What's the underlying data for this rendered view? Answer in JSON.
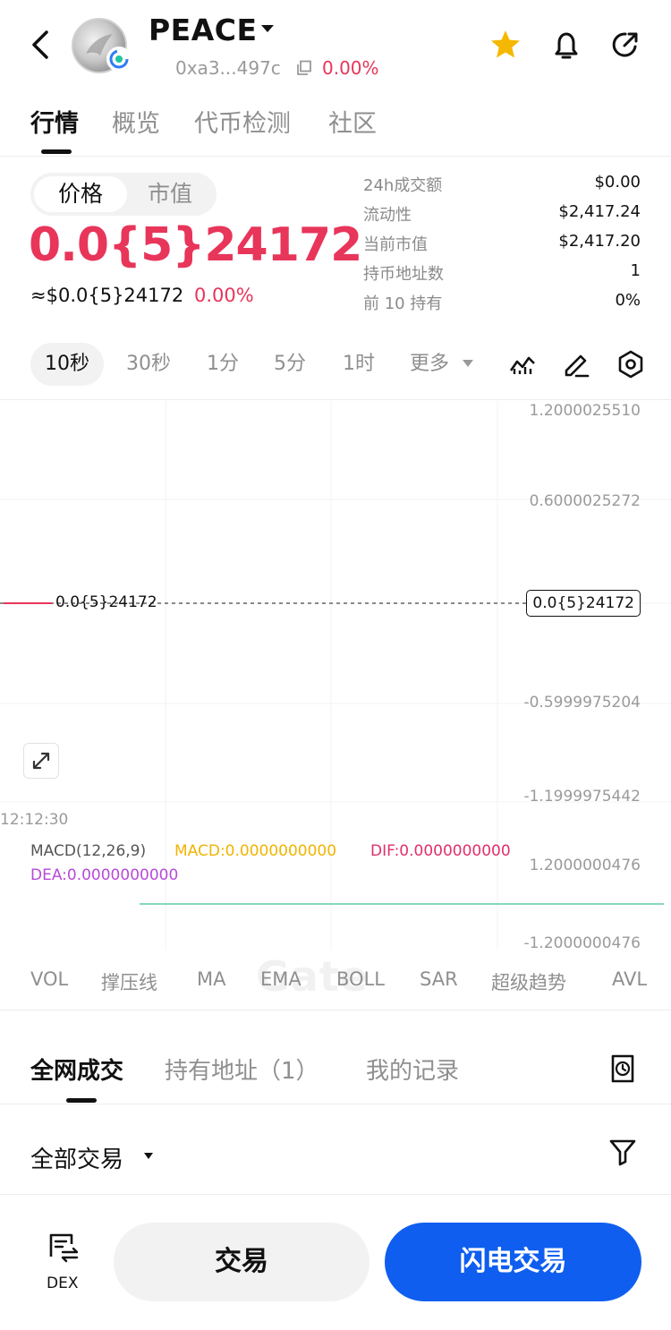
{
  "header": {
    "token_name": "PEACE",
    "address": "0xa3...497c",
    "change": "0.00%"
  },
  "tabs": [
    {
      "label": "行情",
      "active": true
    },
    {
      "label": "概览",
      "active": false
    },
    {
      "label": "代币检测",
      "active": false
    },
    {
      "label": "社区",
      "active": false
    }
  ],
  "price": {
    "toggle": [
      "价格",
      "市值"
    ],
    "value": "0.0{5}24172",
    "approx_usd": "≈$0.0{5}24172",
    "change": "0.00%"
  },
  "stats": [
    {
      "label": "24h成交额",
      "value": "$0.00"
    },
    {
      "label": "流动性",
      "value": "$2,417.24"
    },
    {
      "label": "当前市值",
      "value": "$2,417.20"
    },
    {
      "label": "持币地址数",
      "value": "1"
    },
    {
      "label": "前 10 持有",
      "value": "0%"
    }
  ],
  "timeframes": [
    "10秒",
    "30秒",
    "1分",
    "5分",
    "1时",
    "更多"
  ],
  "chart": {
    "watermark": "Gate",
    "y_labels": [
      "1.2000025510",
      "0.6000025272",
      "-0.5999975204",
      "-1.1999975442"
    ],
    "current_price": "0.0{5}24172",
    "time_label": "12:12:30",
    "macd": {
      "title": "MACD(12,26,9)",
      "macd": "MACD:0.0000000000",
      "dif": "DIF:0.0000000000",
      "dea": "DEA:0.0000000000",
      "upper": "1.2000000476",
      "lower": "-1.2000000476"
    }
  },
  "indicators": [
    "VOL",
    "撑压线",
    "MA",
    "EMA",
    "BOLL",
    "SAR",
    "超级趋势",
    "AVL"
  ],
  "trade_tabs": [
    {
      "label": "全网成交",
      "active": true
    },
    {
      "label": "持有地址（1）",
      "active": false
    },
    {
      "label": "我的记录",
      "active": false
    }
  ],
  "filter": {
    "label": "全部交易"
  },
  "bottom": {
    "dex_label": "DEX",
    "trade_button": "交易",
    "flash_button": "闪电交易"
  },
  "colors": {
    "accent_red": "#e8355a",
    "accent_blue": "#0f5ef0",
    "star": "#f5b800",
    "macd": "#f0b400",
    "dif": "#e0306a",
    "dea": "#b84ad8"
  }
}
